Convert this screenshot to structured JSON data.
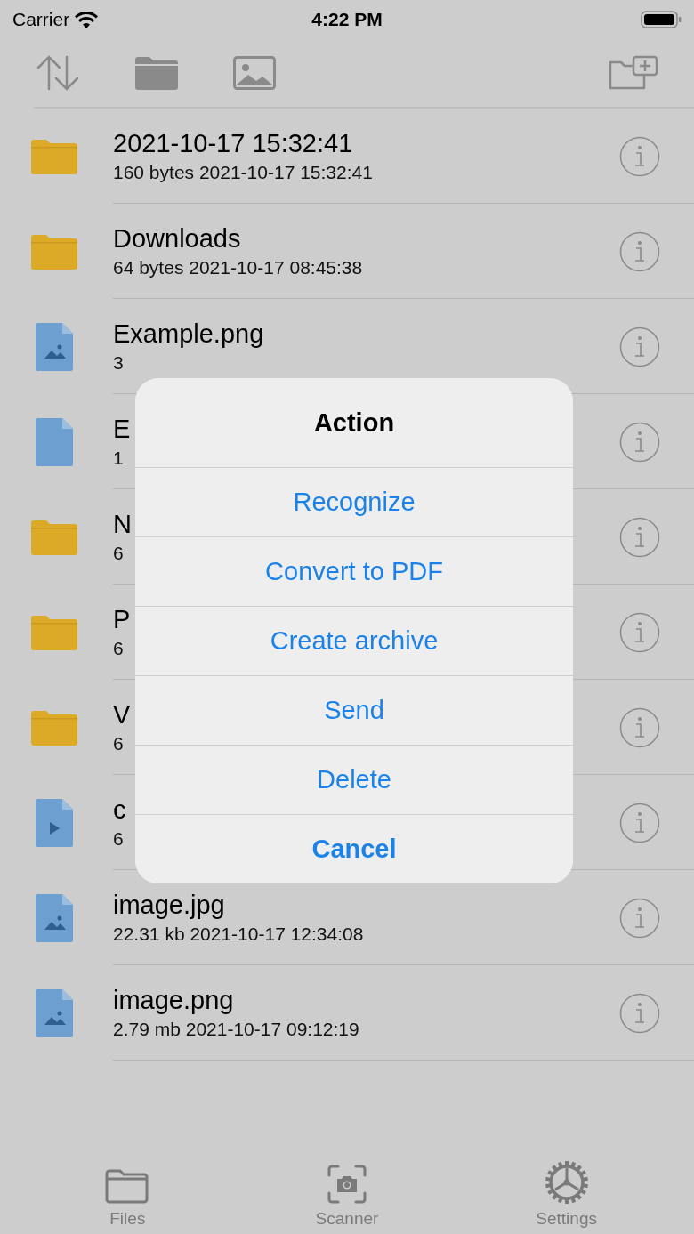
{
  "status_bar": {
    "carrier": "Carrier",
    "time": "4:22 PM"
  },
  "files": [
    {
      "kind": "folder",
      "name": "2021-10-17 15:32:41",
      "details": "160 bytes 2021-10-17 15:32:41"
    },
    {
      "kind": "folder",
      "name": "Downloads",
      "details": "64 bytes 2021-10-17 08:45:38"
    },
    {
      "kind": "image",
      "name": "Example.png",
      "details": "3"
    },
    {
      "kind": "document",
      "name": "E",
      "details": "1"
    },
    {
      "kind": "folder",
      "name": "N",
      "details": "6"
    },
    {
      "kind": "folder",
      "name": "P",
      "details": "6"
    },
    {
      "kind": "folder",
      "name": "V",
      "details": "6"
    },
    {
      "kind": "video",
      "name": "c",
      "details": "6"
    },
    {
      "kind": "image",
      "name": "image.jpg",
      "details": "22.31 kb 2021-10-17 12:34:08"
    },
    {
      "kind": "image",
      "name": "image.png",
      "details": "2.79 mb 2021-10-17 09:12:19"
    }
  ],
  "dialog": {
    "title": "Action",
    "actions": [
      {
        "label": "Recognize",
        "kind": "default"
      },
      {
        "label": "Convert to PDF",
        "kind": "default"
      },
      {
        "label": "Create archive",
        "kind": "default"
      },
      {
        "label": "Send",
        "kind": "default"
      },
      {
        "label": "Delete",
        "kind": "default"
      },
      {
        "label": "Cancel",
        "kind": "cancel"
      }
    ]
  },
  "tab_bar": [
    {
      "label": "Files",
      "kind": "folder"
    },
    {
      "label": "Scanner",
      "kind": "camera"
    },
    {
      "label": "Settings",
      "kind": "gear"
    }
  ]
}
